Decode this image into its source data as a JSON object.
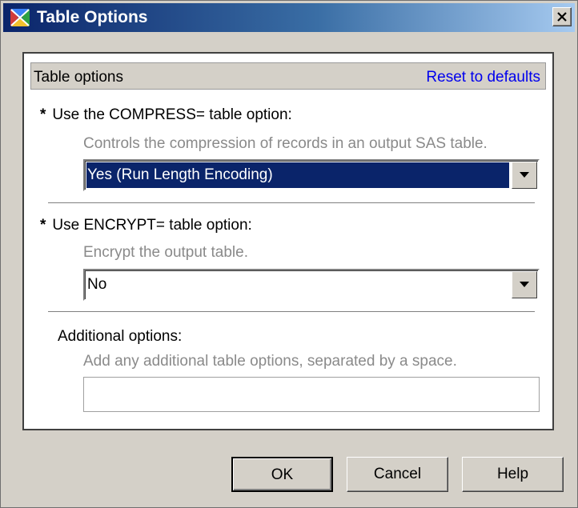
{
  "window": {
    "title": "Table Options"
  },
  "panel": {
    "header_title": "Table options",
    "reset_link": "Reset to defaults"
  },
  "compress": {
    "asterisk": "*",
    "label": "Use the COMPRESS= table option:",
    "description": "Controls the compression of records in an output SAS table.",
    "selected_value": "Yes (Run Length Encoding)"
  },
  "encrypt": {
    "asterisk": "*",
    "label": "Use ENCRYPT= table option:",
    "description": "Encrypt the output table.",
    "selected_value": "No"
  },
  "additional": {
    "label": "Additional options:",
    "description": "Add any additional table options, separated by a space.",
    "value": ""
  },
  "buttons": {
    "ok": "OK",
    "cancel": "Cancel",
    "help": "Help"
  },
  "colors": {
    "title_gradient_start": "#0a246a",
    "title_gradient_end": "#a6caf0",
    "dialog_face": "#d4d0c8",
    "selection": "#0a246a",
    "link": "#0000ee"
  },
  "icons": {
    "title": "table-options-app-icon",
    "close": "close-icon",
    "dropdown": "chevron-down-icon"
  }
}
